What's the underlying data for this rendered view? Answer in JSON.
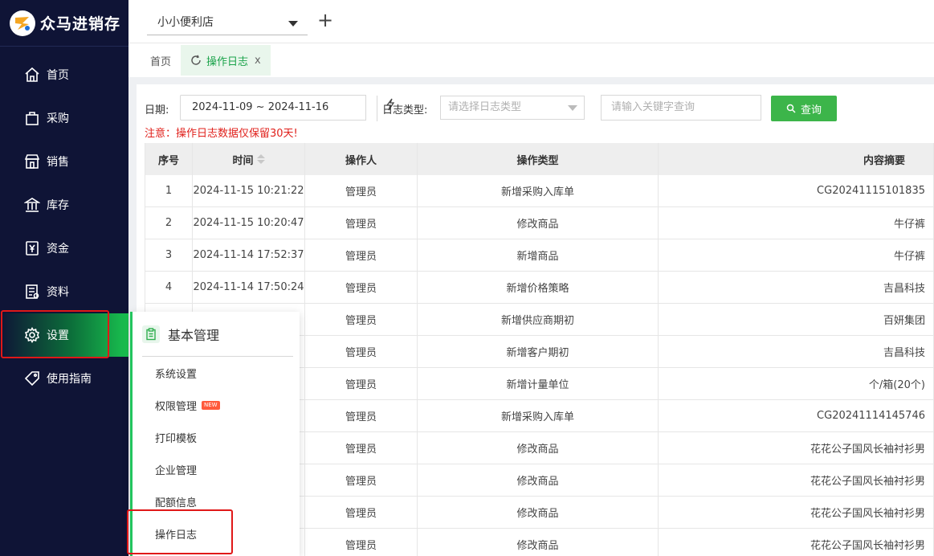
{
  "app": {
    "name": "众马进销存"
  },
  "sidebar": {
    "items": [
      {
        "label": "首页",
        "icon": "home-icon"
      },
      {
        "label": "采购",
        "icon": "bag-icon"
      },
      {
        "label": "销售",
        "icon": "store-icon"
      },
      {
        "label": "库存",
        "icon": "warehouse-icon"
      },
      {
        "label": "资金",
        "icon": "yen-icon"
      },
      {
        "label": "资料",
        "icon": "document-icon"
      },
      {
        "label": "设置",
        "icon": "gear-icon",
        "active": true
      },
      {
        "label": "使用指南",
        "icon": "tag-icon"
      }
    ]
  },
  "topbar": {
    "store": "小小便利店",
    "add_label": "+"
  },
  "tabs": [
    {
      "label": "首页"
    },
    {
      "label": "操作日志",
      "active": true,
      "close": "x"
    }
  ],
  "filters": {
    "date_label": "日期:",
    "date_range": "2024-11-09 ~ 2024-11-16",
    "type_label": "日志类型:",
    "type_placeholder": "请选择日志类型",
    "keyword_placeholder": "请输入关键字查询",
    "query_label": "查询",
    "notice": "注意：操作日志数据仅保留30天!"
  },
  "table": {
    "headers": {
      "no": "序号",
      "time": "时间",
      "operator": "操作人",
      "op_type": "操作类型",
      "summary": "内容摘要"
    },
    "rows": [
      {
        "no": "1",
        "time": "2024-11-15 10:21:22",
        "operator": "管理员",
        "op_type": "新增采购入库单",
        "summary": "CG20241115101835"
      },
      {
        "no": "2",
        "time": "2024-11-15 10:20:47",
        "operator": "管理员",
        "op_type": "修改商品",
        "summary": "牛仔裤"
      },
      {
        "no": "3",
        "time": "2024-11-14 17:52:37",
        "operator": "管理员",
        "op_type": "新增商品",
        "summary": "牛仔裤"
      },
      {
        "no": "4",
        "time": "2024-11-14 17:50:24",
        "operator": "管理员",
        "op_type": "新增价格策略",
        "summary": "吉昌科技"
      },
      {
        "no": "",
        "time": "",
        "operator": "管理员",
        "op_type": "新增供应商期初",
        "summary": "百妍集团"
      },
      {
        "no": "",
        "time": "",
        "operator": "管理员",
        "op_type": "新增客户期初",
        "summary": "吉昌科技"
      },
      {
        "no": "",
        "time": "",
        "operator": "管理员",
        "op_type": "新增计量单位",
        "summary": "个/箱(20个)"
      },
      {
        "no": "",
        "time": "",
        "operator": "管理员",
        "op_type": "新增采购入库单",
        "summary": "CG20241114145746"
      },
      {
        "no": "",
        "time": "",
        "operator": "管理员",
        "op_type": "修改商品",
        "summary": "花花公子国风长袖衬衫男"
      },
      {
        "no": "",
        "time": "",
        "operator": "管理员",
        "op_type": "修改商品",
        "summary": "花花公子国风长袖衬衫男"
      },
      {
        "no": "",
        "time": "",
        "operator": "管理员",
        "op_type": "修改商品",
        "summary": "花花公子国风长袖衬衫男"
      },
      {
        "no": "",
        "time": "",
        "operator": "管理员",
        "op_type": "修改商品",
        "summary": "花花公子国风长袖衬衫男"
      }
    ]
  },
  "flyout": {
    "title": "基本管理",
    "items": [
      {
        "label": "系统设置"
      },
      {
        "label": "权限管理",
        "badge": "NEW"
      },
      {
        "label": "打印模板"
      },
      {
        "label": "企业管理"
      },
      {
        "label": "配额信息"
      },
      {
        "label": "操作日志"
      }
    ]
  },
  "colors": {
    "sidebar_bg": "#0f1436",
    "accent_green": "#3cb54a",
    "notice_red": "#e0201b"
  }
}
